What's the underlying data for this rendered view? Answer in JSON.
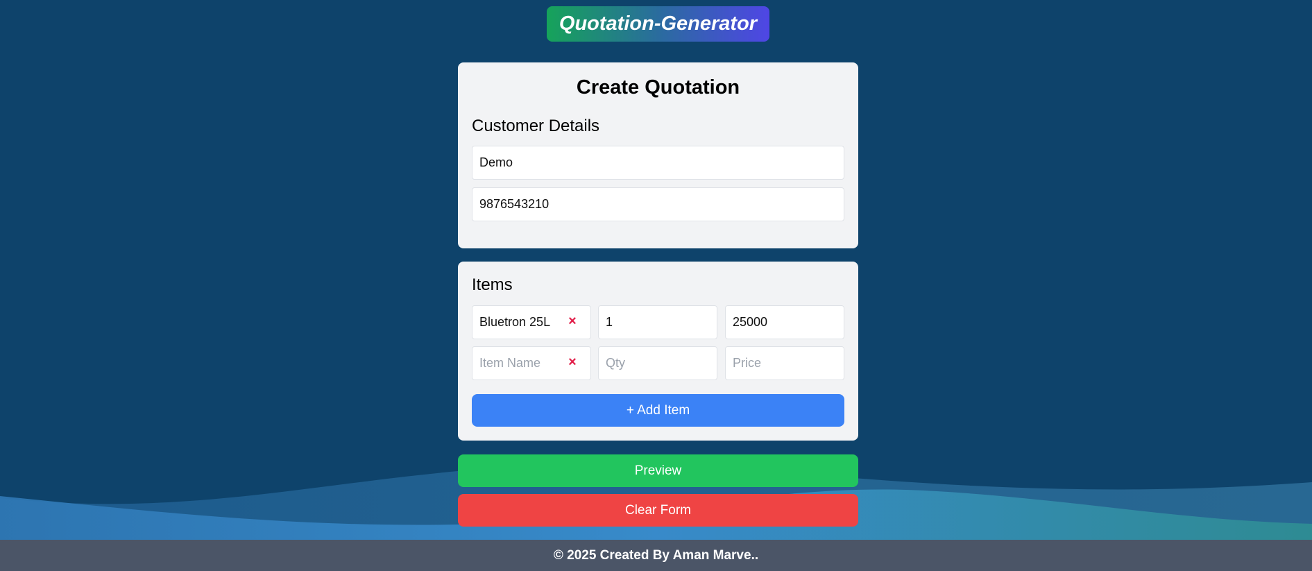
{
  "app": {
    "title": "Quotation-Generator"
  },
  "customer_card": {
    "heading": "Create Quotation",
    "section_title": "Customer Details",
    "name_value": "Demo",
    "phone_value": "9876543210"
  },
  "items_card": {
    "section_title": "Items",
    "rows": [
      {
        "name": "Bluetron 25L",
        "qty": "1",
        "price": "25000"
      },
      {
        "name": "",
        "qty": "",
        "price": ""
      }
    ],
    "placeholders": {
      "name": "Item Name",
      "qty": "Qty",
      "price": "Price"
    },
    "remove_icon": "×",
    "add_label": "+ Add Item"
  },
  "actions": {
    "preview_label": "Preview",
    "clear_label": "Clear Form"
  },
  "footer": {
    "text": "© 2025 Created By Aman Marve.."
  },
  "colors": {
    "background": "#0e436b",
    "card": "#f2f3f5",
    "add_button": "#3b82f6",
    "preview_button": "#22c55e",
    "clear_button": "#ef4444",
    "remove_icon": "#e11d48",
    "footer": "#4b5567"
  },
  "icons": {
    "remove": "close-icon"
  }
}
